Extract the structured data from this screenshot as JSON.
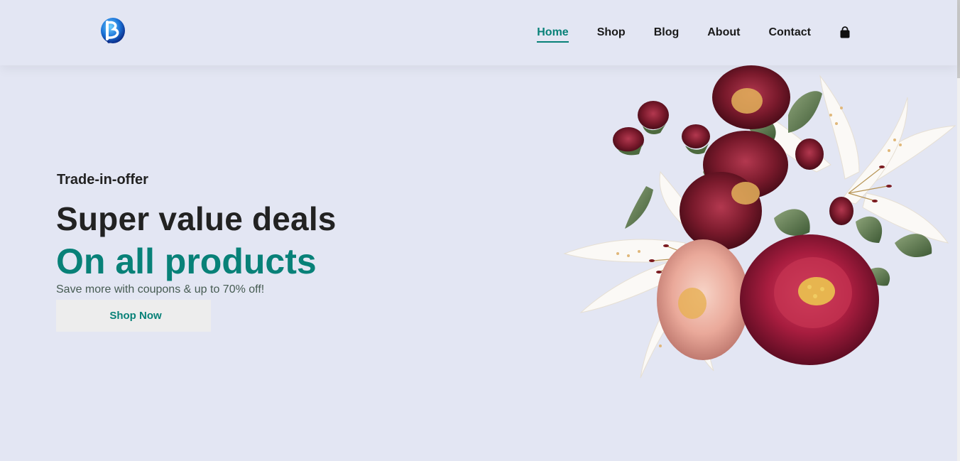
{
  "header": {
    "nav": [
      {
        "label": "Home",
        "active": true
      },
      {
        "label": "Shop",
        "active": false
      },
      {
        "label": "Blog",
        "active": false
      },
      {
        "label": "About",
        "active": false
      },
      {
        "label": "Contact",
        "active": false
      }
    ],
    "icons": {
      "logo": "logo-icon",
      "bag": "shopping-bag-icon"
    }
  },
  "hero": {
    "eyebrow": "Trade-in-offer",
    "headline": "Super value deals",
    "highlight": "On all products",
    "subtext": "Save more with coupons & up to 70% off!",
    "cta_label": "Shop Now"
  },
  "colors": {
    "background": "#e3e6f3",
    "accent": "#088178",
    "text": "#222222",
    "button_bg": "#ededed"
  }
}
